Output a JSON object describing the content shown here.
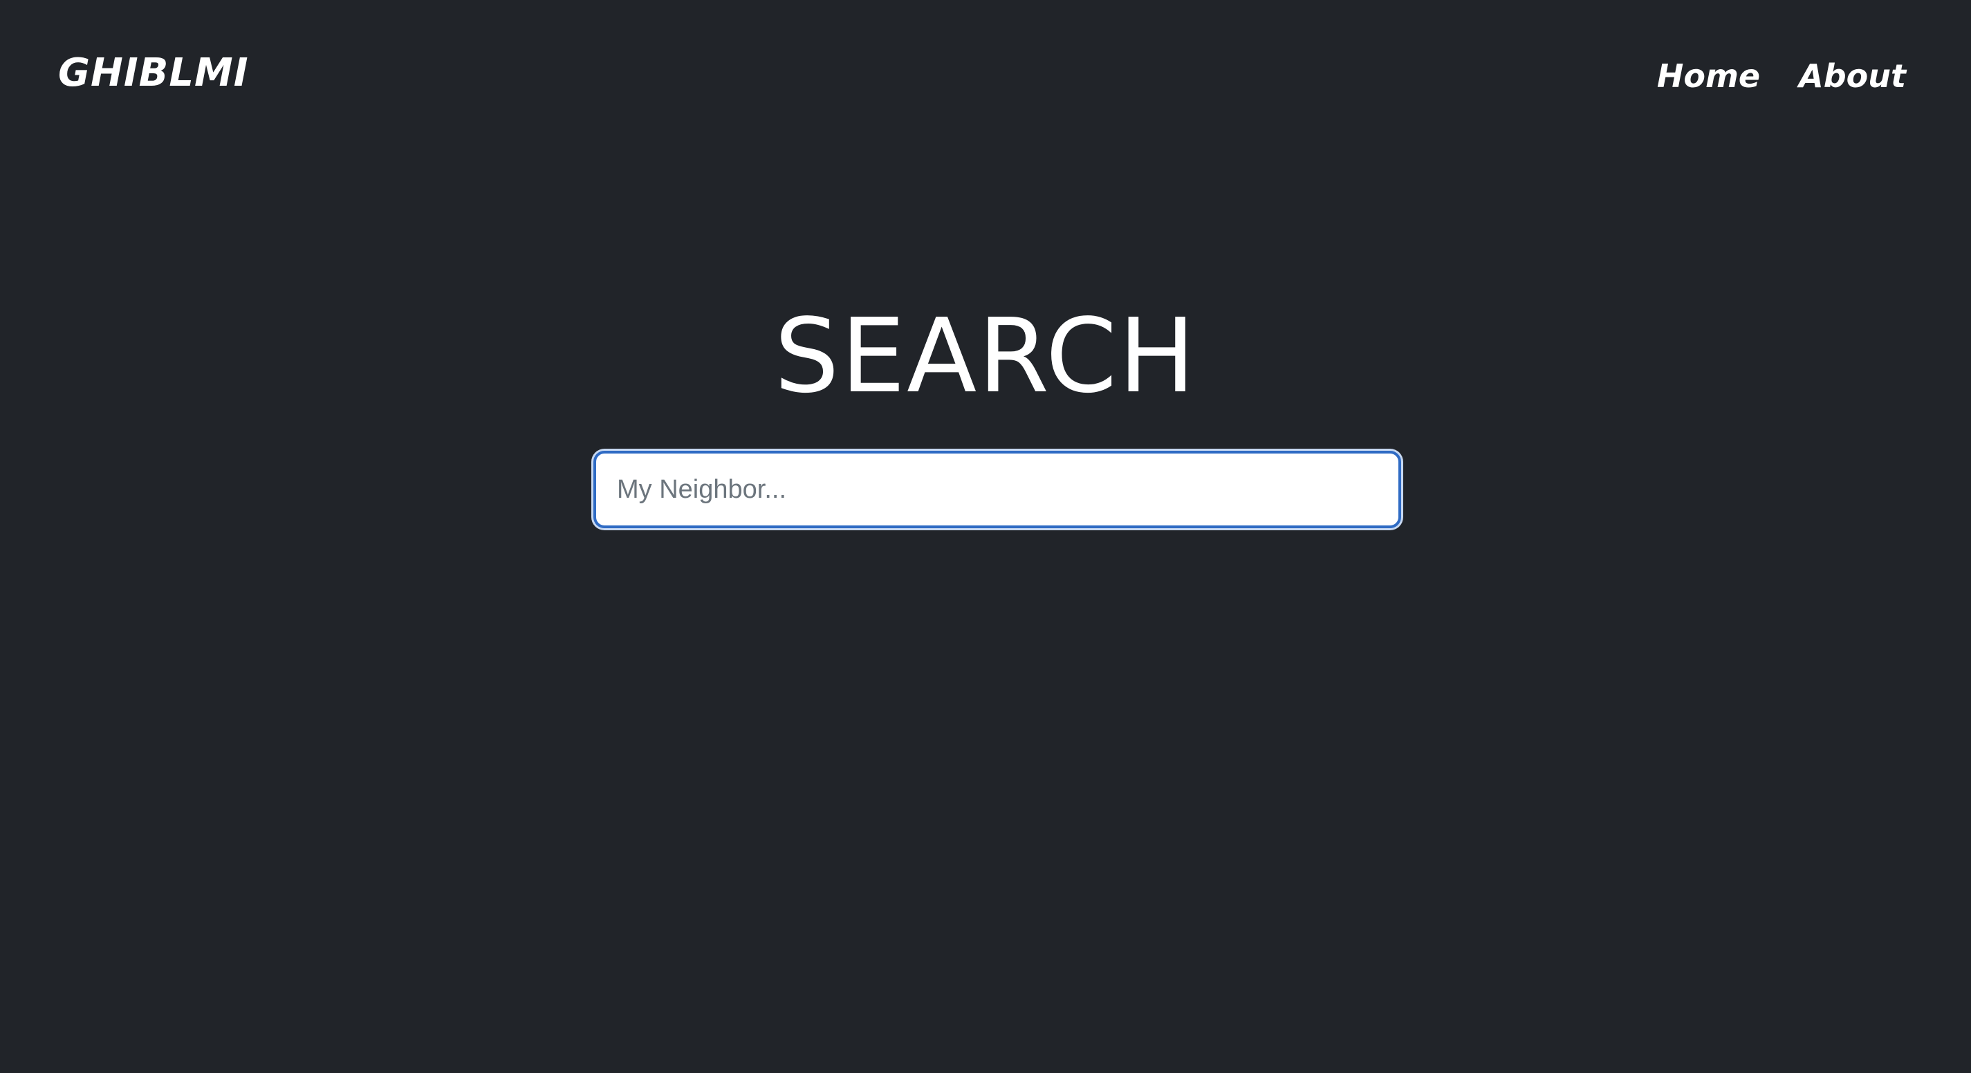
{
  "navbar": {
    "brand": "GHIBLMI",
    "links": [
      {
        "label": "Home"
      },
      {
        "label": "About"
      }
    ]
  },
  "main": {
    "title": "SEARCH",
    "search": {
      "value": "",
      "placeholder": "My Neighbor..."
    }
  },
  "colors": {
    "background": "#212429",
    "text": "#ffffff",
    "focus_border": "#2f6bc4"
  }
}
